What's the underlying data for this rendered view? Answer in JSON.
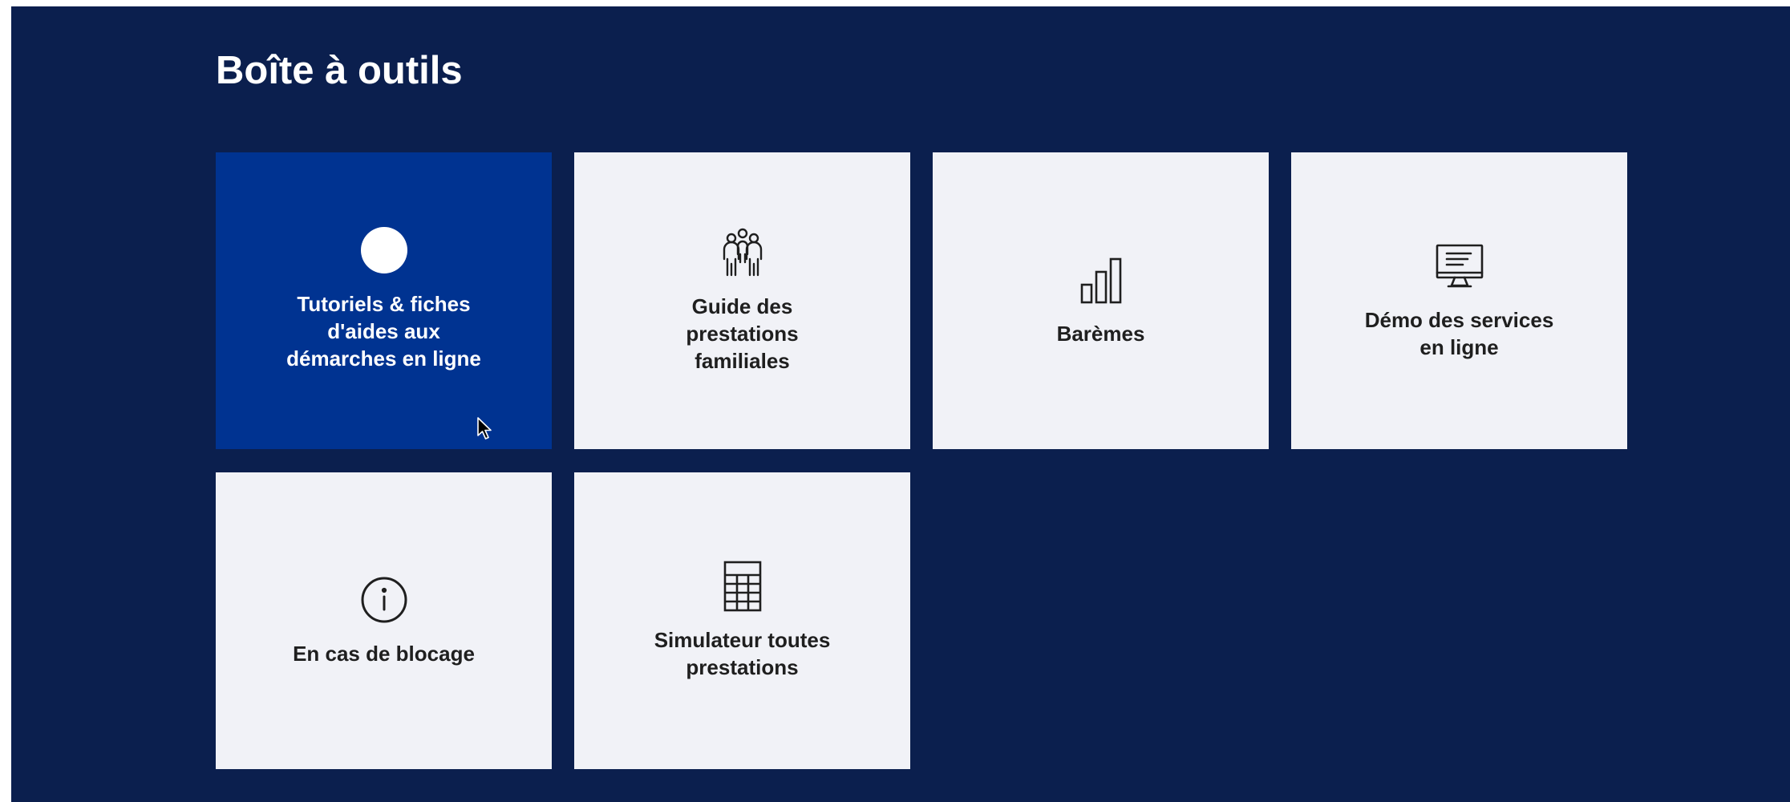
{
  "section": {
    "title": "Boîte à outils"
  },
  "tiles": [
    {
      "label": "Tutoriels & fiches d'aides aux démarches en ligne",
      "icon": "circle-icon",
      "state": "hovered"
    },
    {
      "label": "Guide des prestations familiales",
      "icon": "family-icon"
    },
    {
      "label": "Barèmes",
      "icon": "bar-chart-icon"
    },
    {
      "label": "Démo des services en ligne",
      "icon": "monitor-icon"
    },
    {
      "label": "En cas de blocage",
      "icon": "info-icon"
    },
    {
      "label": "Simulateur toutes prestations",
      "icon": "calculator-icon"
    }
  ],
  "colors": {
    "panel_background": "#0b1f4e",
    "tile_background": "#f1f2f7",
    "tile_active_background": "#003391",
    "tile_text": "#1f1f1f",
    "title_text": "#ffffff"
  }
}
